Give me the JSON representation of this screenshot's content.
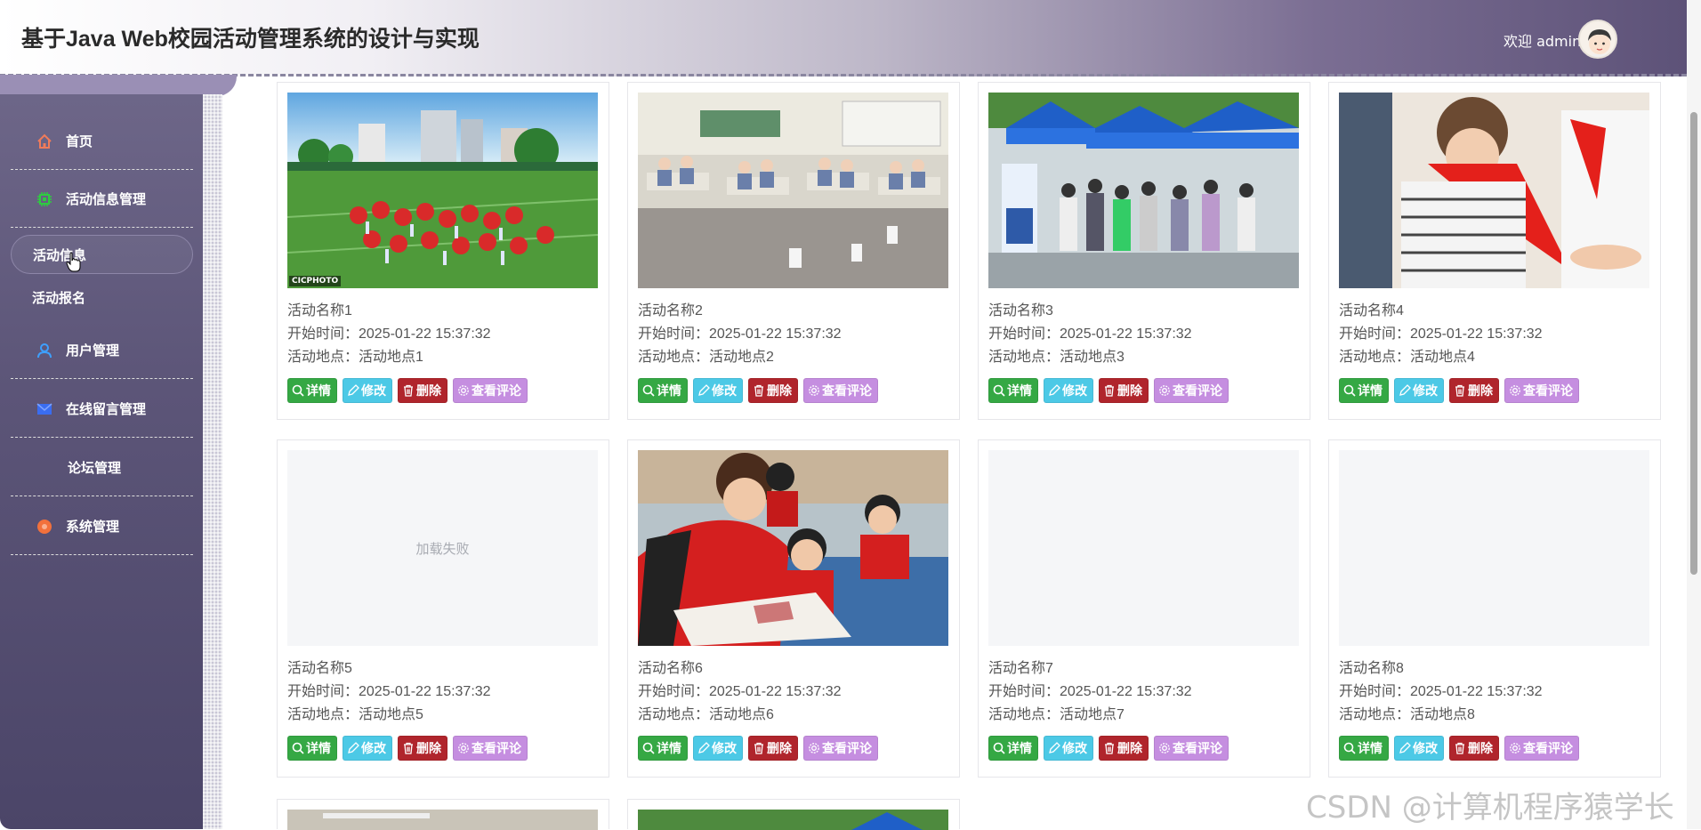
{
  "header": {
    "title": "基于Java Web校园活动管理系统的设计与实现",
    "welcome": "欢迎 admin"
  },
  "sidebar": {
    "items": [
      {
        "label": "首页",
        "icon": "home-icon"
      },
      {
        "label": "活动信息管理",
        "icon": "chip-icon"
      },
      {
        "label": "活动信息",
        "icon": ""
      },
      {
        "label": "活动报名",
        "icon": ""
      },
      {
        "label": "用户管理",
        "icon": "user-icon"
      },
      {
        "label": "在线留言管理",
        "icon": "message-icon"
      },
      {
        "label": "论坛管理",
        "icon": ""
      },
      {
        "label": "系统管理",
        "icon": "settings-icon"
      }
    ],
    "active": "活动信息"
  },
  "buttons": {
    "detail": "详情",
    "edit": "修改",
    "delete": "删除",
    "comments": "查看评论"
  },
  "cards": [
    {
      "name": "活动名称1",
      "time": "开始时间：2025-01-22 15:37:32",
      "place": "活动地点：活动地点1",
      "image": "dance",
      "badge": "CICPHOTO"
    },
    {
      "name": "活动名称2",
      "time": "开始时间：2025-01-22 15:37:32",
      "place": "活动地点：活动地点2",
      "image": "classroom"
    },
    {
      "name": "活动名称3",
      "time": "开始时间：2025-01-22 15:37:32",
      "place": "活动地点：活动地点3",
      "image": "tents"
    },
    {
      "name": "活动名称4",
      "time": "开始时间：2025-01-22 15:37:32",
      "place": "活动地点：活动地点4",
      "image": "scarf"
    },
    {
      "name": "活动名称5",
      "time": "开始时间：2025-01-22 15:37:32",
      "place": "活动地点：活动地点5",
      "image": "failed",
      "fail_text": "加载失败"
    },
    {
      "name": "活动名称6",
      "time": "开始时间：2025-01-22 15:37:32",
      "place": "活动地点：活动地点6",
      "image": "reading"
    },
    {
      "name": "活动名称7",
      "time": "开始时间：2025-01-22 15:37:32",
      "place": "活动地点：活动地点7",
      "image": "blank"
    },
    {
      "name": "活动名称8",
      "time": "开始时间：2025-01-22 15:37:32",
      "place": "活动地点：活动地点8",
      "image": "blank"
    }
  ],
  "watermark": "CSDN @计算机程序猿学长",
  "colors": {
    "detail": "#35a844",
    "edit": "#4cc9e6",
    "delete": "#b0252c",
    "comments": "#c58ee0",
    "sidebar": "#5c5578"
  }
}
